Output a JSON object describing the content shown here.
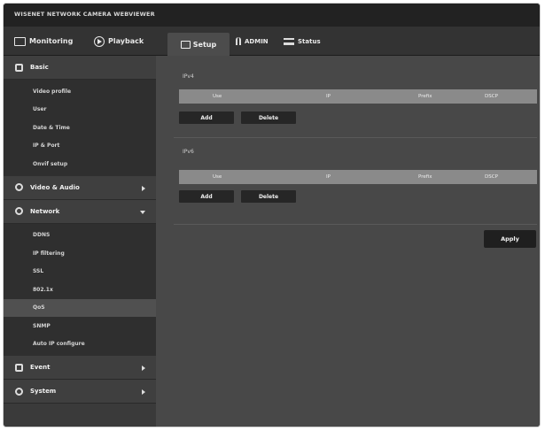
{
  "window": {
    "title": "WISENET NETWORK CAMERA WEBVIEWER"
  },
  "nav": {
    "monitoring": "Monitoring",
    "playback": "Playback",
    "setup": "Setup",
    "user": "ADMIN",
    "status": "Status"
  },
  "sidebar": {
    "basic": {
      "label": "Basic",
      "items": [
        "Video profile",
        "User",
        "Date & Time",
        "IP & Port",
        "Onvif setup"
      ]
    },
    "video_audio": {
      "label": "Video & Audio"
    },
    "network": {
      "label": "Network",
      "items": [
        "DDNS",
        "IP filtering",
        "SSL",
        "802.1x",
        "QoS",
        "SNMP",
        "Auto IP configure"
      ]
    },
    "event": {
      "label": "Event"
    },
    "system": {
      "label": "System"
    }
  },
  "content": {
    "ipv4": {
      "label": "IPv4",
      "columns": [
        "Use",
        "IP",
        "Prefix",
        "DSCP"
      ],
      "add": "Add",
      "delete": "Delete"
    },
    "ipv6": {
      "label": "IPv6",
      "columns": [
        "Use",
        "IP",
        "Prefix",
        "DSCP"
      ],
      "add": "Add",
      "delete": "Delete"
    },
    "apply": "Apply"
  }
}
